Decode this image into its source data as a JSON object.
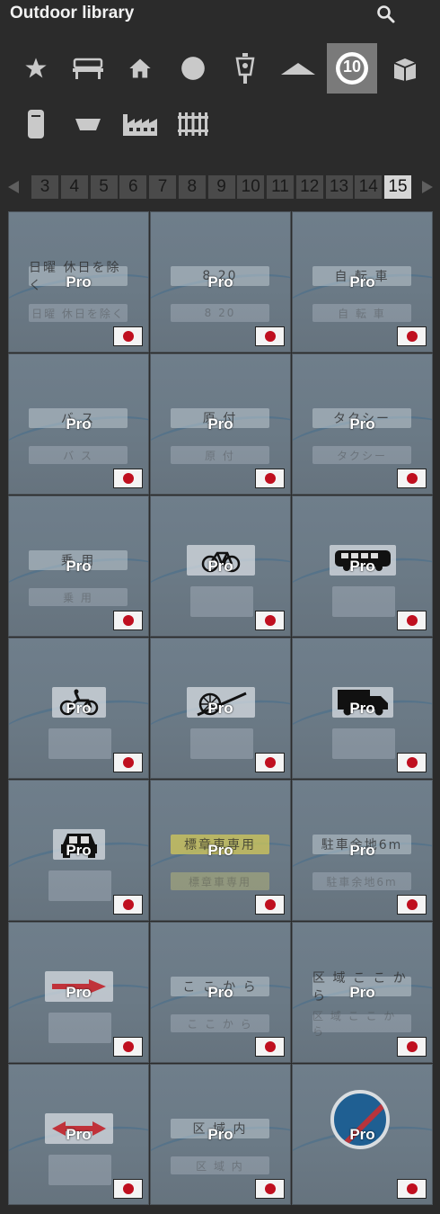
{
  "header": {
    "title": "Outdoor library",
    "search_icon": "search-icon"
  },
  "categories": [
    {
      "icon": "star-icon"
    },
    {
      "icon": "bench-icon"
    },
    {
      "icon": "house-icon"
    },
    {
      "icon": "circle-icon"
    },
    {
      "icon": "lamp-icon"
    },
    {
      "icon": "roof-icon"
    },
    {
      "icon": "traffic-sign-icon",
      "label": "10",
      "active": true
    },
    {
      "icon": "box-icon"
    },
    {
      "icon": "cylinder-icon"
    },
    {
      "icon": "planter-icon"
    },
    {
      "icon": "factory-icon"
    },
    {
      "icon": "fence-icon"
    }
  ],
  "pagination": {
    "pages": [
      "3",
      "4",
      "5",
      "6",
      "7",
      "8",
      "9",
      "10",
      "11",
      "12",
      "13",
      "14",
      "15"
    ],
    "current": "15"
  },
  "tiles": [
    {
      "sign": "日曜 休日を除く",
      "ghost": "日曜 休日を除く",
      "badge": "Pro"
    },
    {
      "sign": "8 20",
      "ghost": "8 20",
      "badge": "Pro"
    },
    {
      "sign": "自 転 車",
      "ghost": "自 転 車",
      "badge": "Pro"
    },
    {
      "sign": "バ ス",
      "ghost": "バ ス",
      "badge": "Pro"
    },
    {
      "sign": "原 付",
      "ghost": "原 付",
      "badge": "Pro"
    },
    {
      "sign": "タクシー",
      "ghost": "タクシー",
      "badge": "Pro"
    },
    {
      "sign": "乗 用",
      "ghost": "乗 用",
      "badge": "Pro"
    },
    {
      "pict": "bicycle",
      "badge": "Pro"
    },
    {
      "pict": "bus",
      "badge": "Pro"
    },
    {
      "pict": "motorbike",
      "badge": "Pro"
    },
    {
      "pict": "cart",
      "badge": "Pro"
    },
    {
      "pict": "truck",
      "badge": "Pro"
    },
    {
      "pict": "car",
      "badge": "Pro"
    },
    {
      "sign": "標章車専用",
      "ghost": "標章車専用",
      "yellow": true,
      "badge": "Pro"
    },
    {
      "sign": "駐車余地6m",
      "ghost": "駐車余地6m",
      "badge": "Pro"
    },
    {
      "pict": "arrow-right",
      "badge": "Pro"
    },
    {
      "sign": "こ こ か ら",
      "ghost": "こ こ か ら",
      "badge": "Pro"
    },
    {
      "sign": "区 域 こ こ か ら",
      "ghost": "区 域 こ こ か ら",
      "badge": "Pro"
    },
    {
      "pict": "arrow-both",
      "badge": "Pro"
    },
    {
      "sign": "区 域 内",
      "ghost": "区 域 内",
      "badge": "Pro"
    },
    {
      "pict": "no-parking-end",
      "badge": "Pro"
    }
  ],
  "colors": {
    "flag_red": "#bf0f1f",
    "active_category": "#7a7a7a",
    "active_page": "#d6d6d6"
  }
}
